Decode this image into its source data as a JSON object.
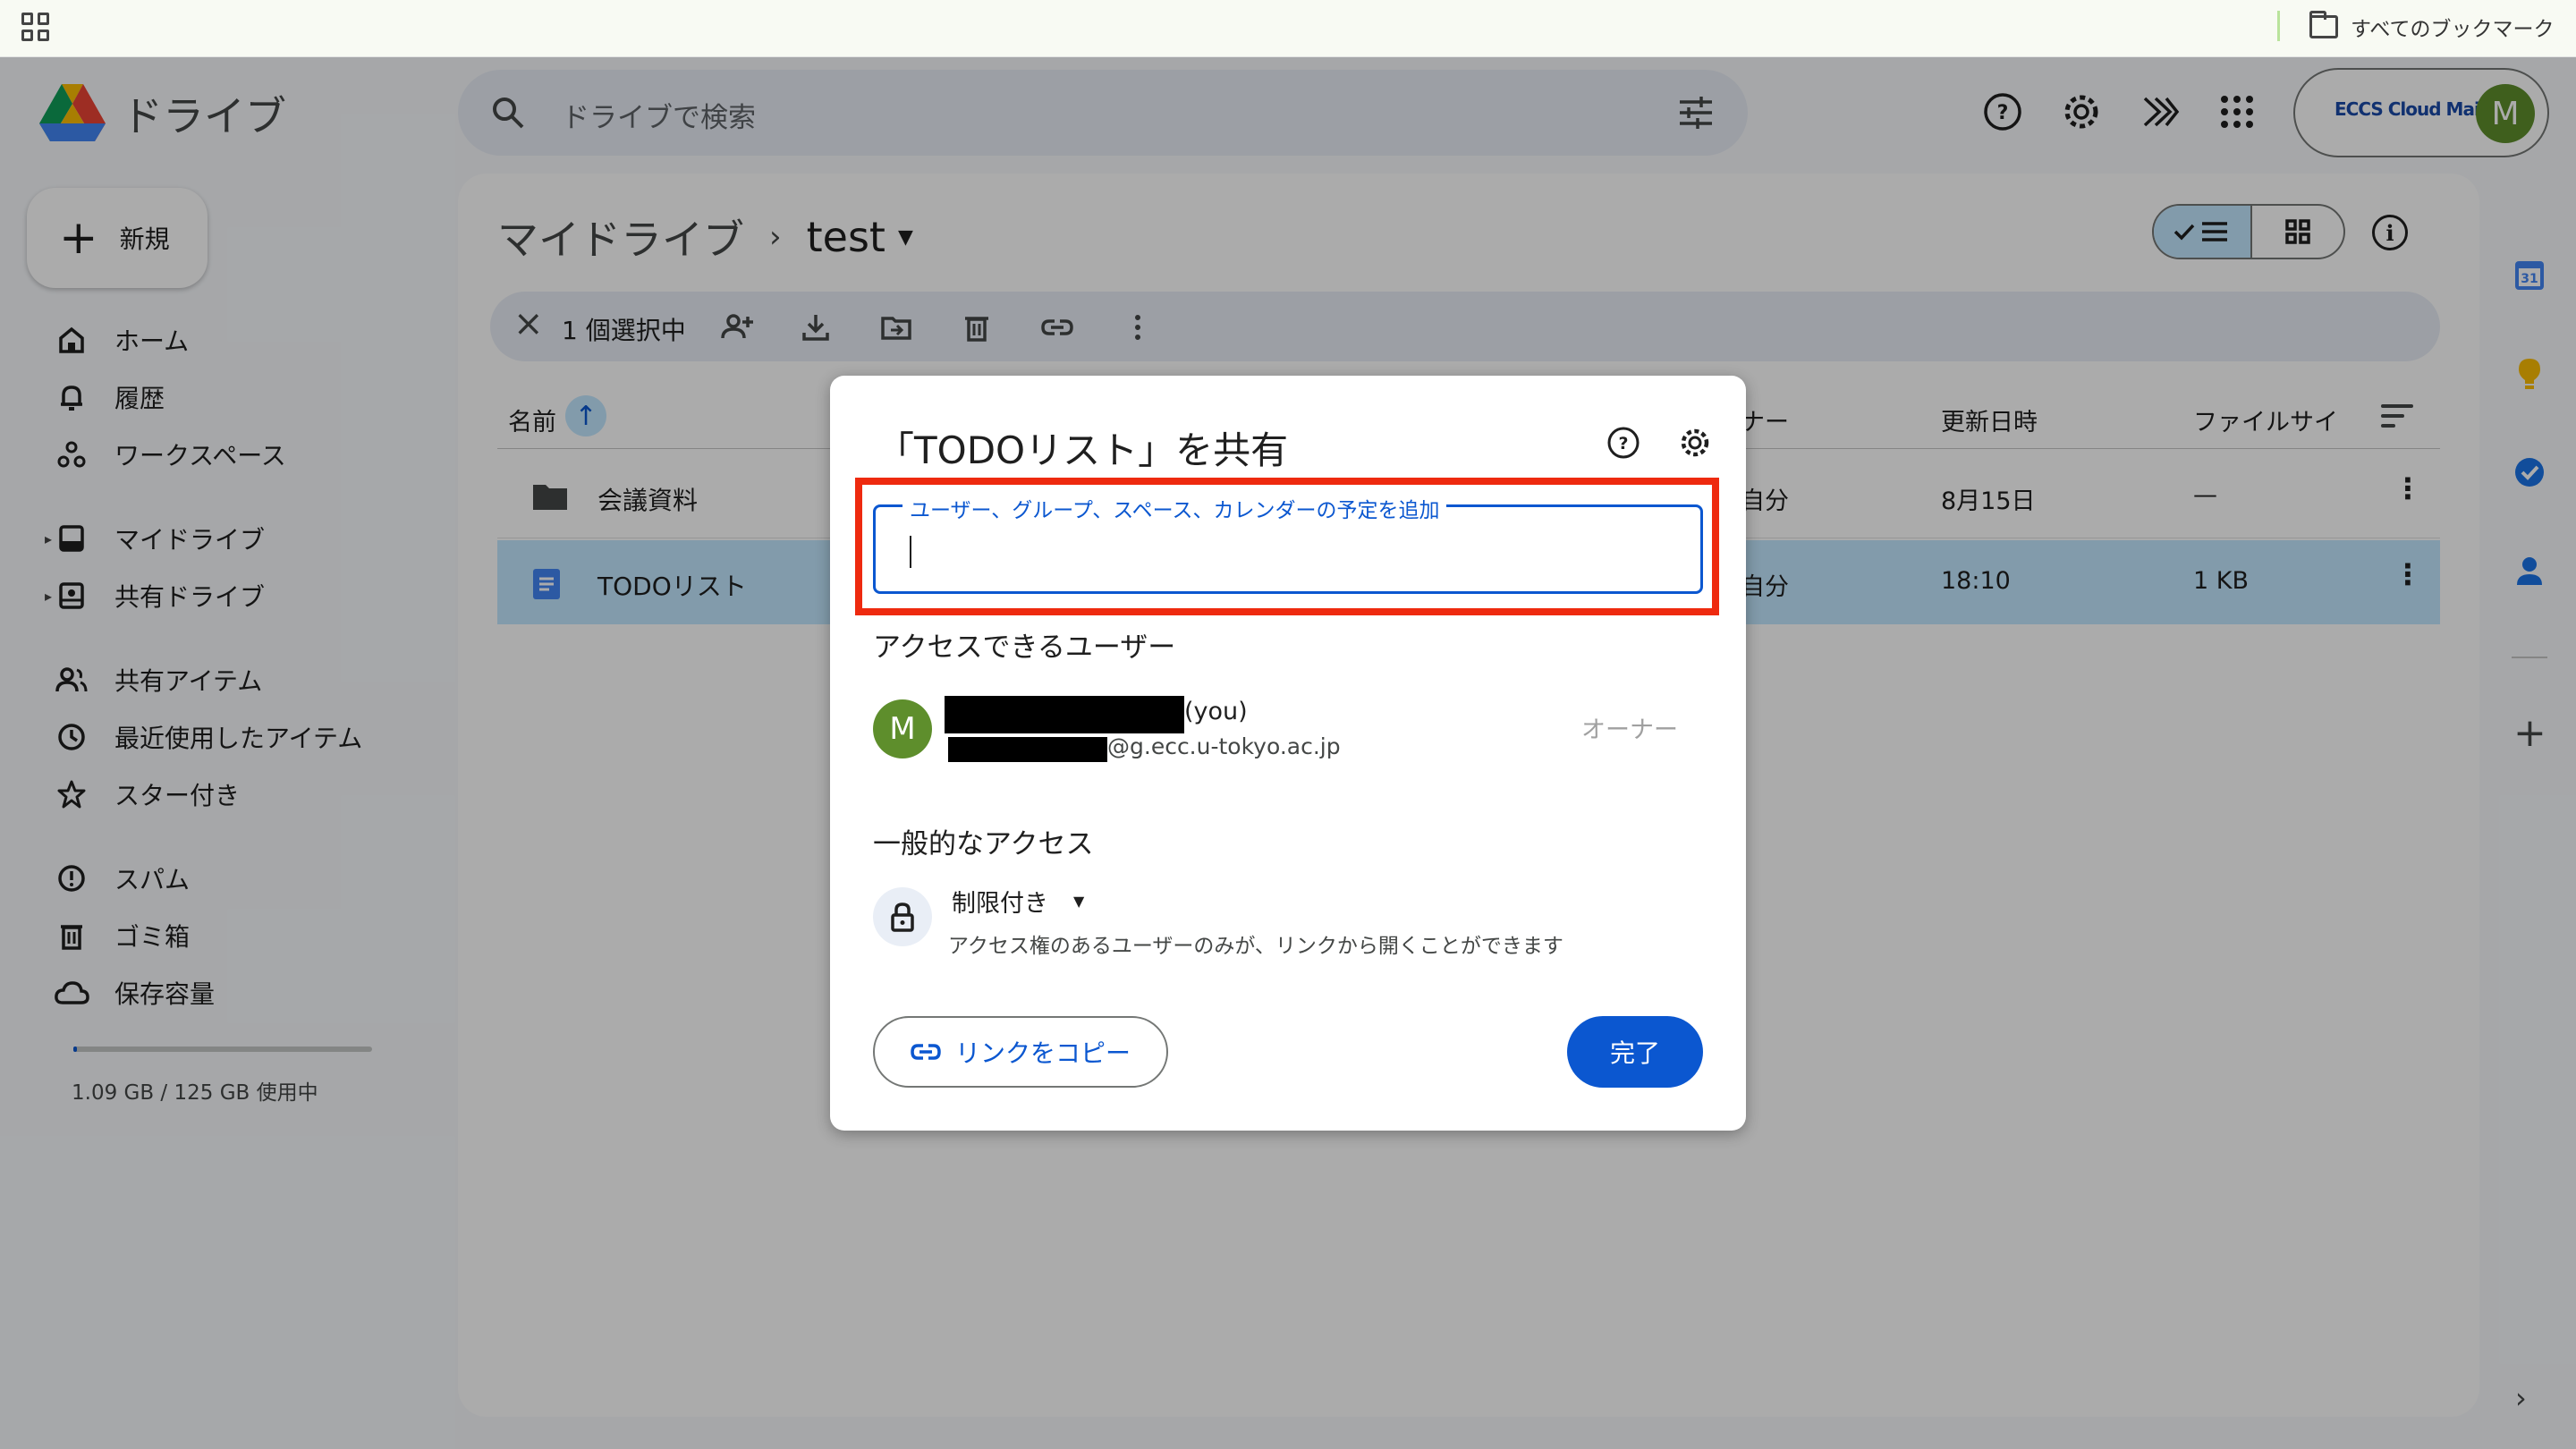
{
  "bookmarks": {
    "all_label": "すべてのブックマーク"
  },
  "app": {
    "name": "ドライブ"
  },
  "search": {
    "placeholder": "ドライブで検索"
  },
  "account": {
    "org_logo": "ECCS Cloud Mail",
    "avatar_letter": "M"
  },
  "sidebar": {
    "new_label": "新規",
    "items": [
      {
        "label": "ホーム",
        "icon": "home-icon"
      },
      {
        "label": "履歴",
        "icon": "bell-icon"
      },
      {
        "label": "ワークスペース",
        "icon": "workspace-icon"
      },
      {
        "label": "マイドライブ",
        "icon": "my-drive-icon"
      },
      {
        "label": "共有ドライブ",
        "icon": "shared-drive-icon"
      },
      {
        "label": "共有アイテム",
        "icon": "people-icon"
      },
      {
        "label": "最近使用したアイテム",
        "icon": "clock-icon"
      },
      {
        "label": "スター付き",
        "icon": "star-icon"
      },
      {
        "label": "スパム",
        "icon": "spam-icon"
      },
      {
        "label": "ゴミ箱",
        "icon": "trash-icon"
      },
      {
        "label": "保存容量",
        "icon": "cloud-icon"
      }
    ],
    "storage_text": "1.09 GB / 125 GB 使用中",
    "storage_fraction": 0.0087
  },
  "breadcrumb": {
    "root": "マイドライブ",
    "current": "test"
  },
  "actionbar": {
    "selected_text": "1 個選択中"
  },
  "table": {
    "columns": {
      "name": "名前",
      "owner": "ナー",
      "modified": "更新日時",
      "size": "ファイルサイ"
    },
    "rows": [
      {
        "name": "会議資料",
        "type": "folder",
        "owner": "自分",
        "modified": "8月15日",
        "size": "—"
      },
      {
        "name": "TODOリスト",
        "type": "doc",
        "owner": "自分",
        "modified": "18:10",
        "size": "1 KB"
      }
    ]
  },
  "side_panel": {
    "calendar_day": "31"
  },
  "dialog": {
    "title": "「TODOリスト」を共有",
    "input_label": "ユーザー、グループ、スペース、カレンダーの予定を追加",
    "input_value": "",
    "people_heading": "アクセスできるユーザー",
    "user": {
      "avatar_letter": "M",
      "name_suffix": "(you)",
      "email_suffix": "@g.ecc.u-tokyo.ac.jp",
      "role": "オーナー"
    },
    "general_heading": "一般的なアクセス",
    "access_level": "制限付き",
    "access_desc": "アクセス権のあるユーザーのみが、リンクから開くことができます",
    "copy_link": "リンクをコピー",
    "done": "完了"
  },
  "colors": {
    "accent": "#0b57d0",
    "selected_row": "#c2e7ff",
    "highlight": "#ee2a0f",
    "avatar": "#5e8e2c"
  }
}
